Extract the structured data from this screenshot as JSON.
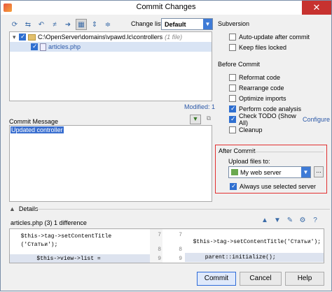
{
  "window": {
    "title": "Commit Changes",
    "close_glyph": "✕"
  },
  "toolbar": {
    "icons": [
      "refresh-icon",
      "move-icon",
      "undo-icon",
      "diff-icon",
      "jump-icon",
      "group-icon",
      "expand-icon",
      "collapse-icon"
    ]
  },
  "changelist": {
    "label": "Change list:",
    "value": "Default"
  },
  "tree": {
    "root_label": "C:\\OpenServer\\domains\\vpawd.lc\\controllers",
    "root_count": "(1 file)",
    "file": "articles.php"
  },
  "modified": "Modified: 1",
  "commit_message": {
    "label": "Commit Message",
    "text": "Updated controller"
  },
  "subversion": {
    "title": "Subversion",
    "options": [
      {
        "label": "Auto-update after commit",
        "checked": false
      },
      {
        "label": "Keep files locked",
        "checked": false
      }
    ]
  },
  "before_commit": {
    "title": "Before Commit",
    "options": [
      {
        "label": "Reformat code",
        "checked": false
      },
      {
        "label": "Rearrange code",
        "checked": false
      },
      {
        "label": "Optimize imports",
        "checked": false
      },
      {
        "label": "Perform code analysis",
        "checked": true
      },
      {
        "label": "Check TODO (Show All)",
        "checked": true
      },
      {
        "label": "Cleanup",
        "checked": false
      }
    ],
    "configure_link": "Configure"
  },
  "after_commit": {
    "title": "After Commit",
    "upload_label": "Upload files to:",
    "server": "My web server",
    "dots": "...",
    "always_label": "Always use selected server",
    "always_checked": true
  },
  "details": {
    "label": "Details",
    "caret": "▲",
    "title": "articles.php (3) 1 difference"
  },
  "diff": {
    "left": [
      "  $this->tag->setContentTitle",
      "  ('Статьи');",
      "",
      "        $this->view->list ="
    ],
    "left_nums": [
      "7",
      "8",
      "9"
    ],
    "right_nums": [
      "7",
      "8",
      "9"
    ],
    "right": [
      "  $this->tag->setContentTitle('Статьи');",
      "",
      "      parent::initialize();"
    ]
  },
  "buttons": {
    "commit": "Commit",
    "cancel": "Cancel",
    "help": "Help"
  }
}
